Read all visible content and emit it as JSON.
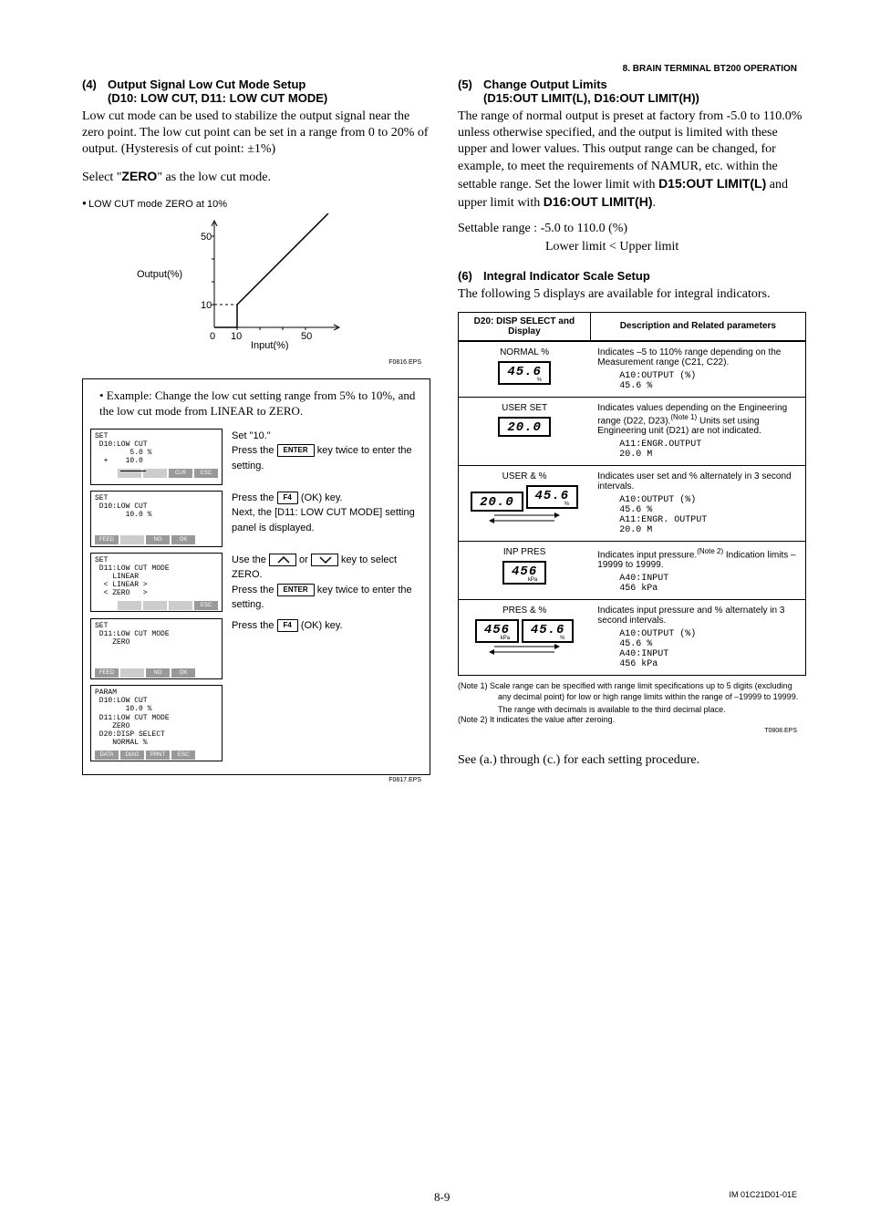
{
  "header": {
    "section": "8.  BRAIN TERMINAL BT200 OPERATION"
  },
  "left": {
    "h4": {
      "num": "(4)",
      "title": "Output Signal Low Cut Mode Setup",
      "sub": "(D10: LOW CUT, D11: LOW CUT MODE)"
    },
    "p1": "Low cut mode can be used to stabilize the output signal near the zero point. The low cut point can be set in a range from 0 to 20% of output. (Hysteresis of cut point: ±1%)",
    "p2a": "Select \"",
    "p2b": "ZERO",
    "p2c": "\" as the low cut mode.",
    "bullet": "LOW CUT mode ZERO at 10%",
    "chart": {
      "ylabel": "Output(%)",
      "xlabel": "Input(%)",
      "y50": "50",
      "y10": "10",
      "x0": "0",
      "x10": "10",
      "x50": "50"
    },
    "eps1": "F0816.EPS",
    "example": {
      "title": "• Example: Change the low cut setting range from 5% to 10%, and the low cut mode from LINEAR to ZERO.",
      "s1_screen": "SET\n D10:LOW CUT\n        5.0 %\n  +    10.0",
      "s1_btns": [
        "",
        "",
        "CLR",
        "ESC"
      ],
      "s1_i1": "Set \"10.\"",
      "s1_i2a": "Press the ",
      "s1_i2b": " key twice to enter the setting.",
      "s1_key": "ENTER",
      "s2_screen": "SET\n D10:LOW CUT\n       10.0 %",
      "s2_btns": [
        "FEED",
        "",
        "NO",
        "OK"
      ],
      "s2_i1a": "Press the ",
      "s2_i1b": " (OK) key.",
      "s2_key": "F4",
      "s2_i2": "Next, the [D11: LOW CUT MODE] setting panel is displayed.",
      "s3_screen": "SET\n D11:LOW CUT MODE\n    LINEAR\n  < LINEAR >\n  < ZERO   >",
      "s3_btns": [
        "",
        "",
        "",
        "ESC"
      ],
      "s3_i1a": "Use the ",
      "s3_i1b": " or ",
      "s3_i1c": " key to select ZERO.",
      "s3_i2a": "Press the ",
      "s3_i2b": " key twice to enter the setting.",
      "s3_key": "ENTER",
      "s4_screen": "SET\n D11:LOW CUT MODE\n    ZERO",
      "s4_btns": [
        "FEED",
        "",
        "NO",
        "OK"
      ],
      "s4_i1a": "Press the ",
      "s4_i1b": " (OK) key.",
      "s4_key": "F4",
      "s5_screen": "PARAM\n D10:LOW CUT\n       10.0 %\n D11:LOW CUT MODE\n    ZERO\n D20:DISP SELECT\n    NORMAL %",
      "s5_btns": [
        "DATA",
        "DIAG",
        "PRNT",
        "ESC"
      ]
    },
    "eps2": "F0817.EPS"
  },
  "right": {
    "h5": {
      "num": "(5)",
      "title": "Change Output Limits",
      "sub": "(D15:OUT LIMIT(L), D16:OUT LIMIT(H))"
    },
    "p5a": "The range of normal output is preset at factory from -5.0 to 110.0% unless otherwise specified, and the output is limited with these upper and lower values. This output range can be changed, for example, to meet the requirements of NAMUR, etc. within the settable range. Set the lower limit with ",
    "p5b": "D15:OUT LIMIT(L)",
    "p5c": " and upper limit with ",
    "p5d": "D16:OUT LIMIT(H)",
    "p5e": ".",
    "settable1": "Settable range :  -5.0 to 110.0 (%)",
    "settable2": "Lower limit < Upper limit",
    "h6": {
      "num": "(6)",
      "title": "Integral Indicator Scale Setup"
    },
    "p6": "The following 5 displays are available for integral indicators.",
    "th1": "D20: DISP SELECT and Display",
    "th2": "Description and Related parameters",
    "rows": [
      {
        "name": "NORMAL %",
        "disp": "45.6",
        "unit": "%",
        "desc": "Indicates –5 to 110% range depending on the Measurement range (C21, C22).",
        "params": [
          "A10:OUTPUT (%)",
          "  45.6 %"
        ]
      },
      {
        "name": "USER SET",
        "disp": "20.0",
        "unit": "",
        "desc": "Indicates values depending on the Engineering range  (D22, D23).",
        "note": "(Note 1)",
        "desc2": " Units set using Engineering unit (D21) are not indicated.",
        "params": [
          "A11:ENGR.OUTPUT",
          "  20.0 M"
        ]
      },
      {
        "name": "USER & %",
        "disp1": "20.0",
        "disp2": "45.6",
        "unit2": "%",
        "desc": "Indicates user set and % alternately in 3 second intervals.",
        "params": [
          "A10:OUTPUT (%)",
          "  45.6 %",
          "A11:ENGR. OUTPUT",
          "  20.0 M"
        ]
      },
      {
        "name": "INP PRES",
        "disp": "456",
        "unit": "kPa",
        "desc": "Indicates input pressure.",
        "note": "(Note 2)",
        "desc2": " Indication limits –19999 to 19999.",
        "params": [
          "A40:INPUT",
          "  456 kPa"
        ]
      },
      {
        "name": "PRES & %",
        "disp1": "456",
        "unit1": "kPa",
        "disp2": "45.6",
        "unit2": "%",
        "desc": "Indicates input pressure and % alternately in 3 second intervals.",
        "params": [
          "A10:OUTPUT (%)",
          "  45.6 %",
          "A40:INPUT",
          "  456 kPa"
        ]
      }
    ],
    "note1": "(Note 1) Scale range can be specified with range limit specifications up to 5 digits (excluding any decimal point) for low or high range limits within the range of –19999 to 19999.",
    "note1b": "The range with decimals is available to the third decimal place.",
    "note2": "(Note 2) It indicates the value after zeroing.",
    "eps3": "T0808.EPS",
    "see": "See (a.) through (c.) for each setting procedure."
  },
  "footer": {
    "page": "8-9",
    "doc": "IM 01C21D01-01E"
  },
  "chart_data": {
    "type": "line",
    "title": "LOW CUT mode ZERO at 10%",
    "xlabel": "Input(%)",
    "ylabel": "Output(%)",
    "xlim": [
      0,
      55
    ],
    "ylim": [
      0,
      55
    ],
    "series": [
      {
        "name": "output",
        "x": [
          0,
          10,
          10,
          50
        ],
        "y": [
          0,
          0,
          10,
          50
        ]
      },
      {
        "name": "guide-h",
        "x": [
          0,
          10
        ],
        "y": [
          10,
          10
        ],
        "style": "dashed"
      },
      {
        "name": "guide-v",
        "x": [
          10,
          10
        ],
        "y": [
          0,
          10
        ],
        "style": "dashed"
      }
    ]
  }
}
